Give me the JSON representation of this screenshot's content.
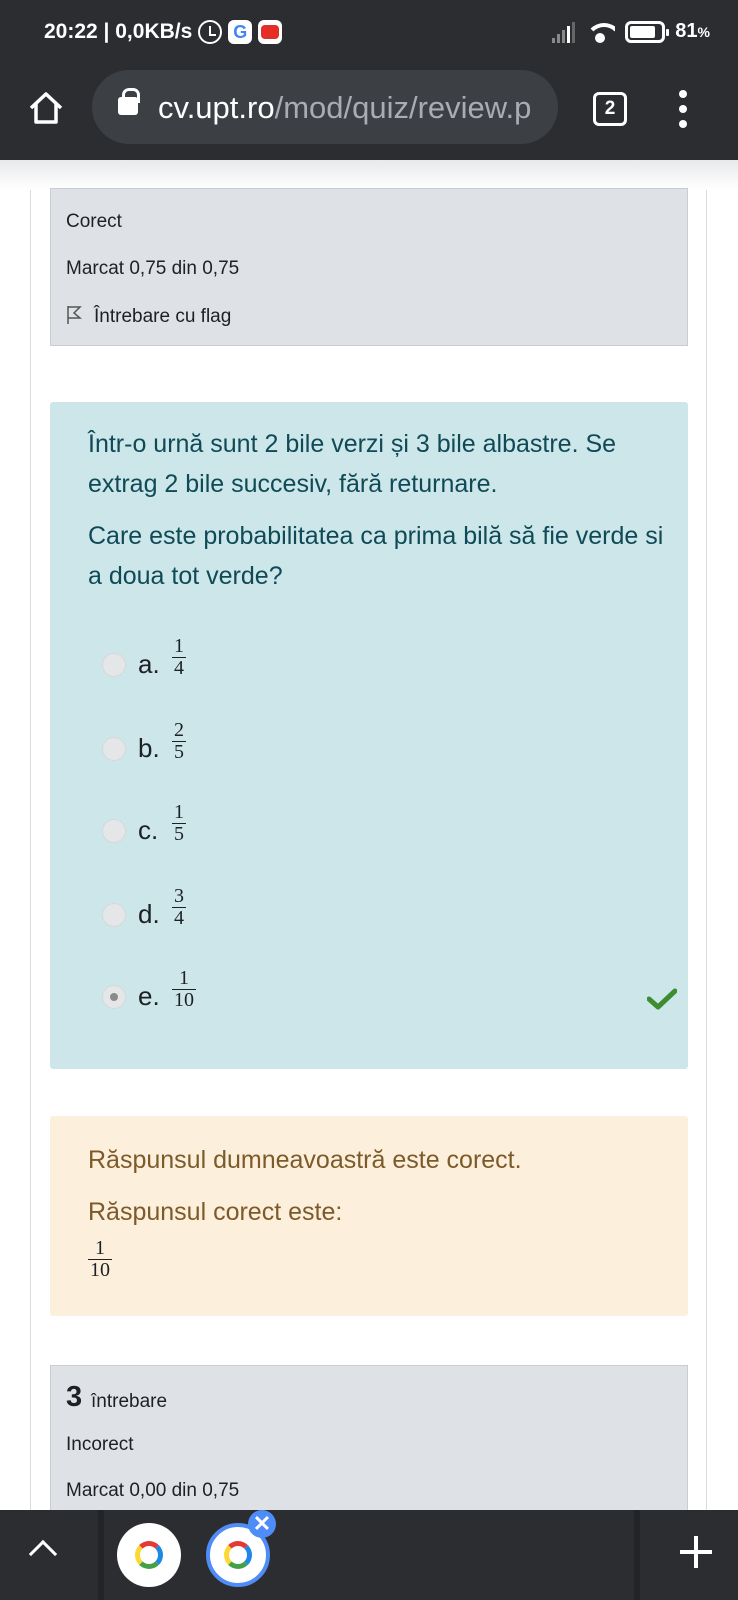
{
  "status_bar": {
    "time_speed": "20:22 | 0,0KB/s",
    "battery": "81",
    "battery_unit": "%",
    "icons": [
      "alarm-icon",
      "google-icon",
      "youtube-icon",
      "signal-icon",
      "wifi-icon",
      "battery-icon"
    ]
  },
  "browser": {
    "url_host": "cv.upt.ro",
    "url_path": "/mod/quiz/review.p",
    "tab_count": "2"
  },
  "prev_question_info": {
    "state": "Corect",
    "mark": "Marcat 0,75 din 0,75",
    "flag_label": "Întrebare cu flag"
  },
  "question": {
    "text_1": "Într-o urnă sunt 2 bile verzi și 3 bile albastre. Se extrag 2 bile succesiv, fără returnare.",
    "text_2": "Care este probabilitatea ca prima bilă să fie verde si a doua tot verde?",
    "options": [
      {
        "letter": "a.",
        "num": "1",
        "den": "4",
        "selected": false
      },
      {
        "letter": "b.",
        "num": "2",
        "den": "5",
        "selected": false
      },
      {
        "letter": "c.",
        "num": "1",
        "den": "5",
        "selected": false
      },
      {
        "letter": "d.",
        "num": "3",
        "den": "4",
        "selected": false
      },
      {
        "letter": "e.",
        "num": "1",
        "den": "10",
        "selected": true
      }
    ],
    "correct_color": "#3d8c2f"
  },
  "feedback": {
    "line_1": "Răspunsul dumneavoastră este corect.",
    "line_2": "Răspunsul corect este:",
    "answer_num": "1",
    "answer_den": "10"
  },
  "next_question_info": {
    "number": "3",
    "word": "întrebare",
    "state": "Incorect",
    "mark": "Marcat 0,00 din 0,75"
  },
  "bottom_bar": {
    "close_symbol": "✕"
  },
  "colors": {
    "chrome_dark": "#2b2d31",
    "question_bg": "#cce6ea",
    "feedback_bg": "#fcefdc",
    "info_bg": "#dee2e6"
  }
}
